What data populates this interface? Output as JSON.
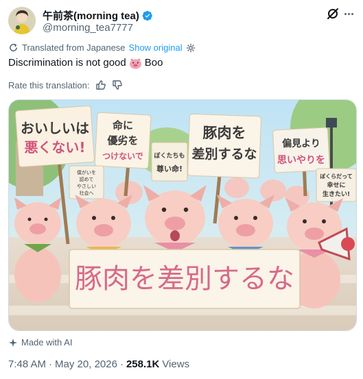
{
  "author": {
    "display_name": "午前茶(morning tea)",
    "handle": "@morning_tea7777",
    "verified": true
  },
  "translation": {
    "label": "Translated from Japanese",
    "show_original": "Show original"
  },
  "tweet": {
    "text_before": "Discrimination is not good",
    "emoji": "pig-face",
    "text_after": "Boo"
  },
  "rating": {
    "label": "Rate this translation:"
  },
  "media": {
    "signs": {
      "sign1_line1": "おいしいは",
      "sign1_line2": "悪くない!",
      "sign2_line1": "命に",
      "sign2_line2": "優劣を",
      "sign2_line3": "つけないで",
      "sign3_line1": "ぼくたちも",
      "sign3_line2": "尊い命!",
      "sign4_line1": "豚肉を",
      "sign4_line2": "差別するな",
      "sign5_line1": "偏見より",
      "sign5_line2": "思いやりを",
      "sign6_line1": "ぼくらだって",
      "sign6_line2": "幸せに",
      "sign6_line3": "生きたい!",
      "sign7_line1": "僕がいを",
      "sign7_line2": "認めて",
      "sign7_line3": "やさしい",
      "sign7_line4": "社会へ",
      "banner": "豚肉を差別するな"
    }
  },
  "ai_label": "Made with AI",
  "meta": {
    "time": "7:48 AM",
    "sep": "·",
    "date": "May 20, 2026",
    "views_count": "258.1K",
    "views_label": "Views"
  },
  "colors": {
    "accent": "#1d9bf0",
    "secondary_text": "#536471",
    "primary_text": "#0f1419",
    "banner_text": "#d66a8a"
  }
}
